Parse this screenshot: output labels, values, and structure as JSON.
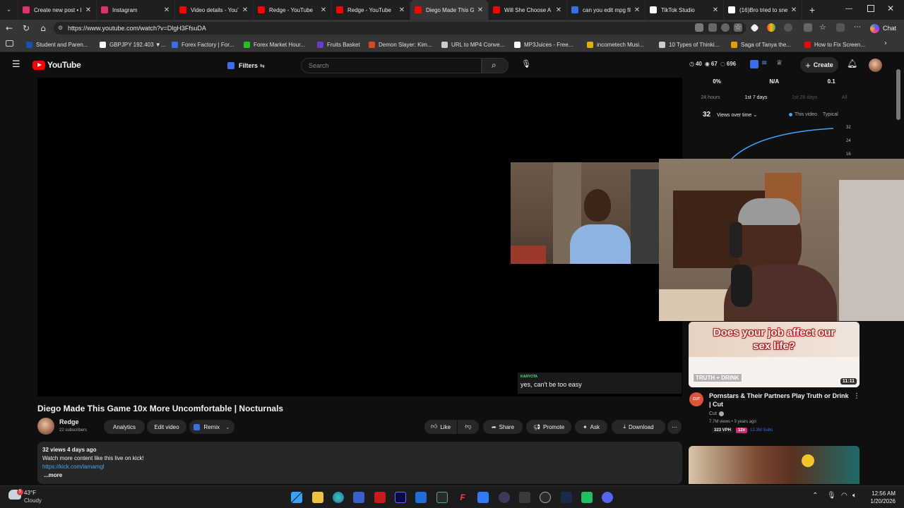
{
  "browser": {
    "tabs": [
      {
        "title": "Create new post • In",
        "color": "#e1306c"
      },
      {
        "title": "Instagram",
        "color": "#e1306c"
      },
      {
        "title": "Video details - YouT",
        "color": "#ff0000"
      },
      {
        "title": "Redge - YouTube",
        "color": "#ff0000"
      },
      {
        "title": "Redge - YouTube",
        "color": "#ff0000"
      },
      {
        "title": "Diego Made This Ga",
        "color": "#ff0000"
      },
      {
        "title": "Will She Choose A L",
        "color": "#ff0000"
      },
      {
        "title": "can you edit mpg fil",
        "color": "#3a6ee8"
      },
      {
        "title": "TikTok Studio",
        "color": "#ffffff"
      },
      {
        "title": "(16)Bro tried to sne",
        "color": "#ffffff"
      }
    ],
    "new_tab": "+",
    "url": "https://www.youtube.com/watch?v=DlgH3FfsuDA",
    "chat_label": "Chat",
    "bookmarks": [
      {
        "label": "Student and Paren...",
        "color": "#1a4fb3"
      },
      {
        "label": "GBPJPY 192.403 ▼...",
        "color": "#ffffff"
      },
      {
        "label": "Forex Factory | For...",
        "color": "#3a6ee8"
      },
      {
        "label": "Forex Market Hour...",
        "color": "#1fc41f"
      },
      {
        "label": "Fruits Basket",
        "color": "#6a3ad1"
      },
      {
        "label": "Demon Slayer: Kim...",
        "color": "#d84a1b"
      },
      {
        "label": "URL to MP4 Conve...",
        "color": "#cccccc"
      },
      {
        "label": "MP3Juices - Free...",
        "color": "#ffffff"
      },
      {
        "label": "incometech Musi...",
        "color": "#e0b000"
      },
      {
        "label": "10 Types of Thinki...",
        "color": "#cccccc"
      },
      {
        "label": "Saga of Tanya the...",
        "color": "#e0a000"
      },
      {
        "label": "How to Fix Screen...",
        "color": "#ff0000"
      }
    ]
  },
  "youtube": {
    "logo_text": "YouTube",
    "filters_label": "Filters",
    "search_placeholder": "Search",
    "header_stats": {
      "a": "40",
      "b": "67",
      "c": "696"
    },
    "create_label": "Create",
    "stats_panel": {
      "top_values": [
        "0%",
        "N/A",
        "0.1"
      ],
      "periods": [
        "24 hours",
        "1st 7 days",
        "1st 28 days",
        "All"
      ],
      "active_period": "1st 7 days",
      "count": "32",
      "metric_label": "Views over time",
      "legend_this": "This video",
      "legend_typical": "Typical",
      "y_ticks": [
        "32",
        "24",
        "16"
      ]
    },
    "video": {
      "title": "Diego Made This Game 10x More Uncomfortable | Nocturnals",
      "chat_user": "KARYOTA",
      "chat_message": "yes, can't be too easy"
    },
    "channel": {
      "name": "Redge",
      "subscribers": "22 subscribers"
    },
    "actions": {
      "analytics": "Analytics",
      "edit_video": "Edit video",
      "remix": "Remix",
      "like": "Like",
      "share": "Share",
      "promote": "Promote",
      "ask": "Ask",
      "download": "Download"
    },
    "description": {
      "stats": "32 views  4 days ago",
      "line1": "Watch more content like this live on kick!",
      "link": "https://kick.com/lamamgl",
      "more": "...more"
    },
    "recommendations": [
      {
        "thumb_text": "Does your job affect our sex life?",
        "thumb_brand": "TRUTH + DRINK",
        "duration": "11:11",
        "title": "Pornstars & Their Partners Play Truth or Drink | Cut",
        "channel": "Cut",
        "meta": "7.7M views • 3 years ago",
        "vph": "323 VPH",
        "multiplier": "12x",
        "subs": "12.3M Subs"
      }
    ]
  },
  "taskbar": {
    "weather_temp": "43°F",
    "weather_desc": "Cloudy",
    "time": "12:56 AM",
    "date": "1/20/2026"
  },
  "colors": {
    "yt_red": "#ff0000",
    "accent_blue": "#3ea6ff",
    "bg": "#0f0f0f"
  }
}
